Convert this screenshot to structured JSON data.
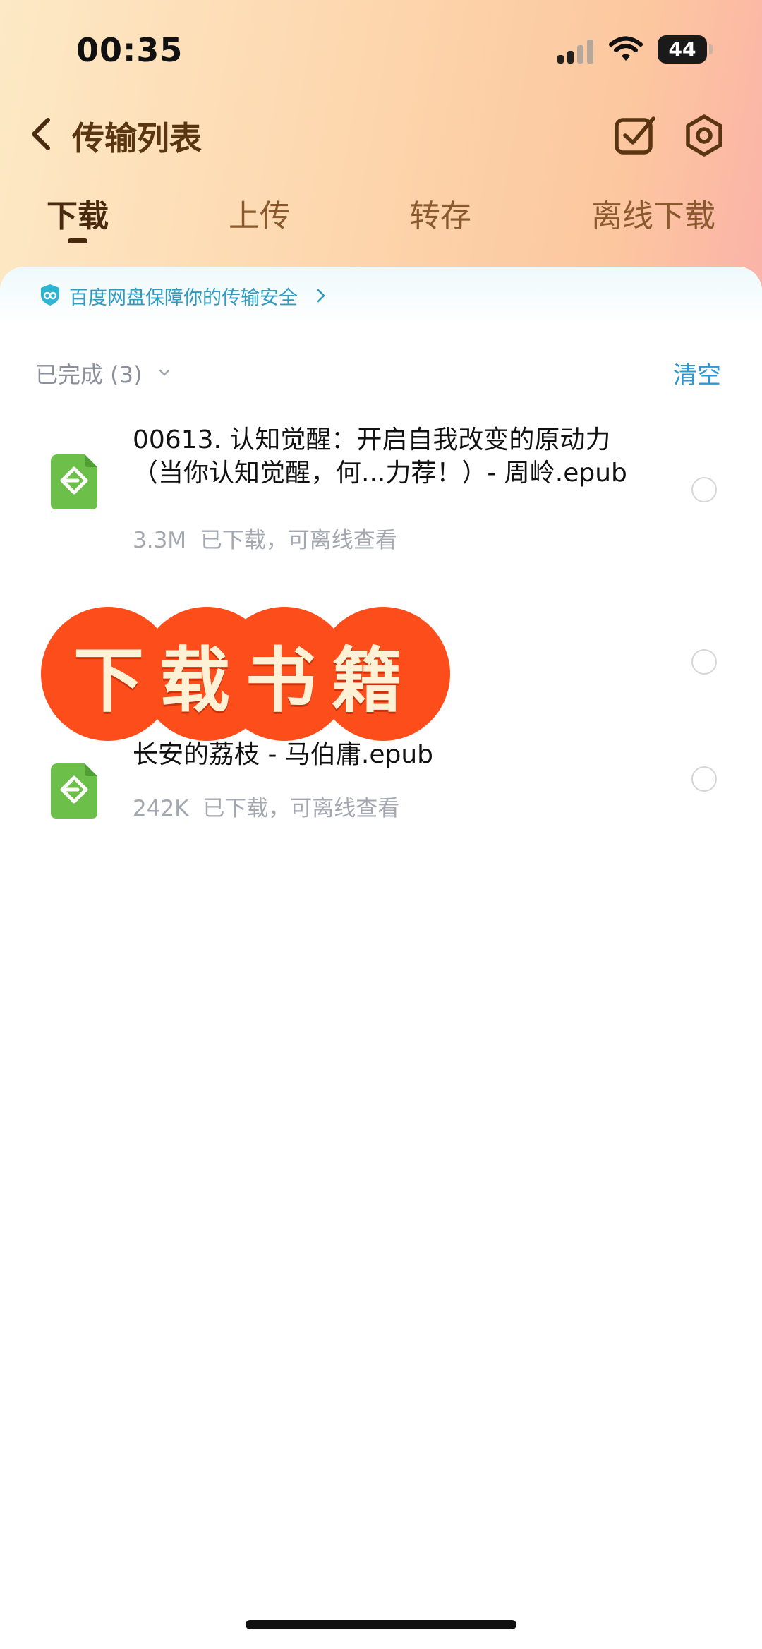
{
  "status_bar": {
    "time": "00:35",
    "battery": "44"
  },
  "nav": {
    "title": "传输列表"
  },
  "tabs": [
    {
      "label": "下载",
      "active": true
    },
    {
      "label": "上传",
      "active": false
    },
    {
      "label": "转存",
      "active": false
    },
    {
      "label": "离线下载",
      "active": false
    }
  ],
  "security": {
    "text": "百度网盘保障你的传输安全"
  },
  "section": {
    "title": "已完成 (3)",
    "clear_label": "清空"
  },
  "files": [
    {
      "name": "00613. 认知觉醒：开启自我改变的原动力（当你认知觉醒，何...力荐！）- 周岭.epub",
      "size": "3.3M",
      "status": "已下载，可离线查看",
      "icon": "epub-file-icon"
    },
    {
      "name": "长安的荔枝 - 马伯庸.epub",
      "size": "242K",
      "status": "已下载，可离线查看",
      "icon": "epub-file-icon"
    }
  ],
  "overlay_banner": {
    "text": "下载书籍"
  },
  "colors": {
    "accent": "#2a97d6",
    "title_brown": "#5a3512",
    "banner_red": "#fd4d1b",
    "epub_green": "#6cc04a"
  }
}
